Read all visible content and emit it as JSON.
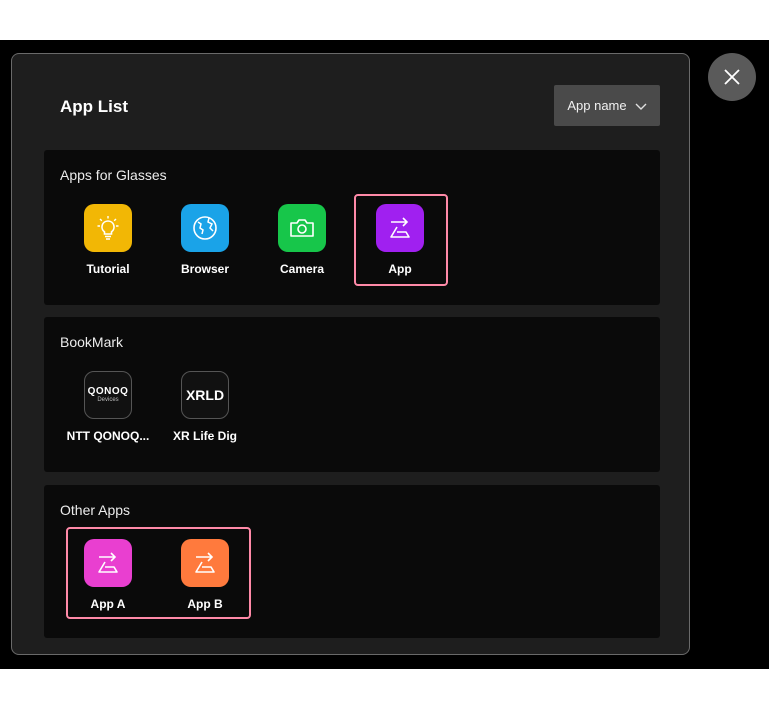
{
  "dialog": {
    "title": "App List"
  },
  "sort": {
    "label": "App name"
  },
  "sections": [
    {
      "title": "Apps for Glasses",
      "apps": [
        {
          "label": "Tutorial",
          "icon": "lightbulb-icon",
          "color": "#f2b705"
        },
        {
          "label": "Browser",
          "icon": "globe-icon",
          "color": "#1aa3e8"
        },
        {
          "label": "Camera",
          "icon": "camera-icon",
          "color": "#17c64a"
        },
        {
          "label": "App",
          "icon": "app-launch-icon",
          "color": "#a020f0"
        }
      ]
    },
    {
      "title": "BookMark",
      "apps": [
        {
          "label": "NTT QONOQ...",
          "icon": "qonoq-logo",
          "logo_text": "QONOQ",
          "logo_sub": "Devices"
        },
        {
          "label": "XR Life Dig",
          "icon": "xrld-logo",
          "logo_text": "XRLD"
        }
      ]
    },
    {
      "title": "Other Apps",
      "apps": [
        {
          "label": "App A",
          "icon": "app-launch-icon",
          "color": "#e93fd0"
        },
        {
          "label": "App B",
          "icon": "app-launch-icon",
          "color": "#ff7a3d"
        }
      ]
    }
  ],
  "colors": {
    "highlight": "#ff8aa8",
    "panel": "#1e1e1e",
    "section": "#0a0a0a"
  }
}
